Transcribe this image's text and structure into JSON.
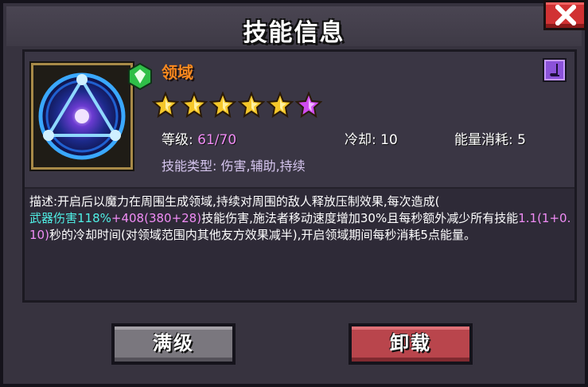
{
  "dialog": {
    "title": "技能信息"
  },
  "skill": {
    "name": "领域",
    "stars_total": 6,
    "stars_gold": 5,
    "stars_purple": 1,
    "level_label": "等级:",
    "level_value": "61/70",
    "cooldown_label": "冷却:",
    "cooldown_value": "10",
    "energy_label": "能量消耗:",
    "energy_value": "5",
    "type_label": "技能类型:",
    "type_value": "伤害,辅助,持续",
    "icon": "magic-circle-icon",
    "gem_icon": "green-gem-icon",
    "element_icon": "purple-element-icon"
  },
  "description": {
    "part1": "描述:开启后以魔力在周围生成领域,持续对周围的敌人释放压制效果,每次造成(",
    "damage_formula_cyan": "武器伤害118%",
    "damage_formula_pink": "+408(380+28)",
    "part2": "技能伤害,施法者移动速度增加30%且每秒额外减少所有技能",
    "cd_reduce": "1.1(1+0.10)",
    "part3": "秒的冷却时间(对领域范围内其他友方效果减半),开启领域期间每秒消耗5点能量。"
  },
  "buttons": {
    "max_level": "满级",
    "unload": "卸载"
  },
  "colors": {
    "name": "#ff8a1e",
    "highlight_cyan": "#4ff0e6",
    "highlight_pink": "#f08cf5",
    "button_gray": "#7a777e",
    "button_red": "#b9454c",
    "close_red": "#d13233"
  }
}
